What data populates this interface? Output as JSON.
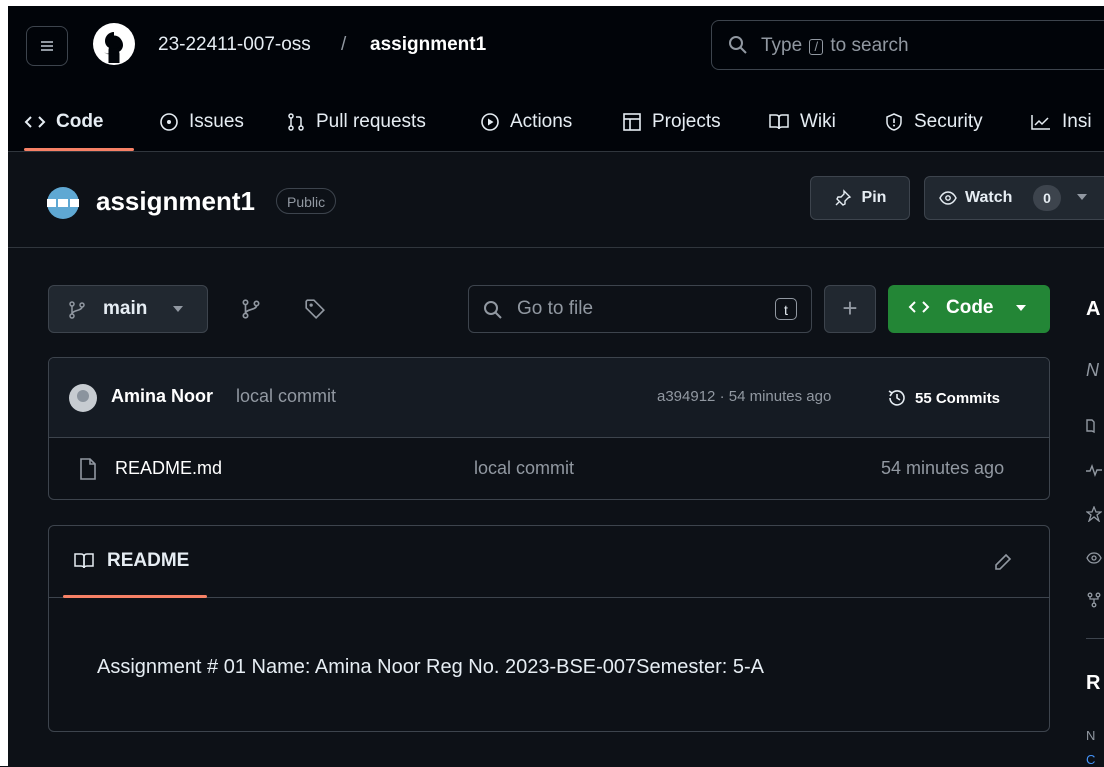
{
  "header": {
    "owner": "23-22411-007-oss",
    "separator": "/",
    "repo": "assignment1",
    "search": {
      "prefix": "Type",
      "key": "/",
      "suffix": "to search"
    }
  },
  "tabs": [
    {
      "label": "Code",
      "icon": "code-icon"
    },
    {
      "label": "Issues",
      "icon": "issue-opened-icon"
    },
    {
      "label": "Pull requests",
      "icon": "git-pull-request-icon"
    },
    {
      "label": "Actions",
      "icon": "play-icon"
    },
    {
      "label": "Projects",
      "icon": "table-icon"
    },
    {
      "label": "Wiki",
      "icon": "book-icon"
    },
    {
      "label": "Security",
      "icon": "shield-icon"
    },
    {
      "label": "Insi",
      "icon": "graph-icon"
    }
  ],
  "repo_header": {
    "name": "assignment1",
    "visibility": "Public",
    "pin_label": "Pin",
    "watch_label": "Watch",
    "watch_count": "0"
  },
  "toolbar": {
    "branch": "main",
    "goto_placeholder": "Go to file",
    "goto_key": "t",
    "plus": "+",
    "code_label": "Code"
  },
  "latest_commit": {
    "author": "Amina Noor",
    "message": "local commit",
    "meta": "a394912 · 54 minutes ago",
    "commits_label": "55 Commits"
  },
  "files": [
    {
      "name": "README.md",
      "message": "local commit",
      "time": "54 minutes ago"
    }
  ],
  "readme": {
    "tab": "README",
    "content": "Assignment # 01 Name: Amina Noor Reg No. 2023-BSE-007Semester: 5-A"
  },
  "sidebar": {
    "about": "A",
    "desc": "N",
    "releases": "R",
    "small": "N",
    "link": "C"
  },
  "colors": {
    "background": "#0d1117",
    "header_bg": "#010409",
    "accent_underline": "#f78166",
    "code_button": "#238636",
    "border": "#3d444d"
  }
}
